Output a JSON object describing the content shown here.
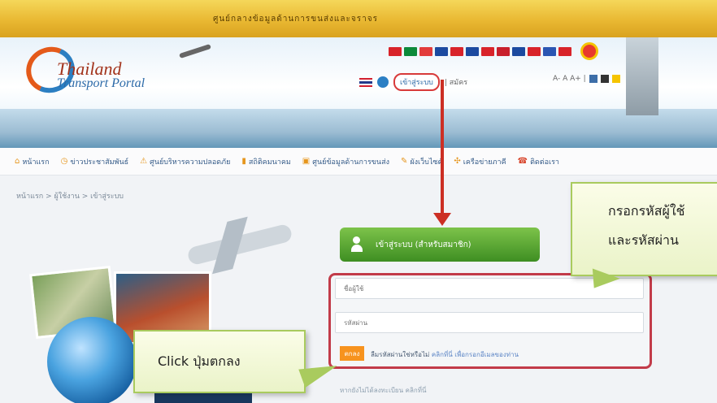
{
  "topbar": {
    "text": "ศูนย์กลางข้อมูลด้านการขนส่งและจราจร"
  },
  "header": {
    "logo_line1": "Thailand",
    "logo_line2": "Transport Portal",
    "login_link": "เข้าสู่ระบบ",
    "register_link": "| สมัคร",
    "right_text": "A- A A+ |"
  },
  "nav": {
    "items": [
      {
        "label": "หน้าแรก",
        "icon": "home-icon"
      },
      {
        "label": "ข่าวประชาสัมพันธ์",
        "icon": "clock-icon"
      },
      {
        "label": "ศูนย์บริหารความปลอดภัย",
        "icon": "warning-icon"
      },
      {
        "label": "สถิติคมนาคม",
        "icon": "chart-icon"
      },
      {
        "label": "ศูนย์ข้อมูลด้านการขนส่ง",
        "icon": "bus-icon"
      },
      {
        "label": "ผังเว็บไซต์",
        "icon": "pencil-icon"
      },
      {
        "label": "เครือข่ายภาคี",
        "icon": "link-icon"
      },
      {
        "label": "ติดต่อเรา",
        "icon": "phone-icon"
      }
    ]
  },
  "breadcrumb": "หน้าแรก > ผู้ใช้งาน > เข้าสู่ระบบ",
  "login": {
    "title": "เข้าสู่ระบบ (สำหรับสมาชิก)",
    "username_placeholder": "ชื่อผู้ใช้",
    "password_placeholder": "รหัสผ่าน",
    "submit_label": "ตกลง",
    "forgot_text": "ลืมรหัสผ่านใช่หรือไม่",
    "forgot_link": "คลิกที่นี่ เพื่อกรอกอีเมลของท่าน",
    "signup_text": "หากยังไม่ได้ลงทะเบียน คลิกที่นี่"
  },
  "callouts": {
    "credentials_line1": "กรอกรหัสผู้ใช้",
    "credentials_line2": "และรหัสผ่าน",
    "click_ok": "Click ปุ่มตกลง"
  },
  "colors": {
    "topbar": "#e9b832",
    "login_banner": "#5aa834",
    "highlight_border": "#c23b49",
    "submit_button": "#f7931e",
    "arrow": "#cc2f24",
    "callout_fill": "#eff6d2"
  }
}
